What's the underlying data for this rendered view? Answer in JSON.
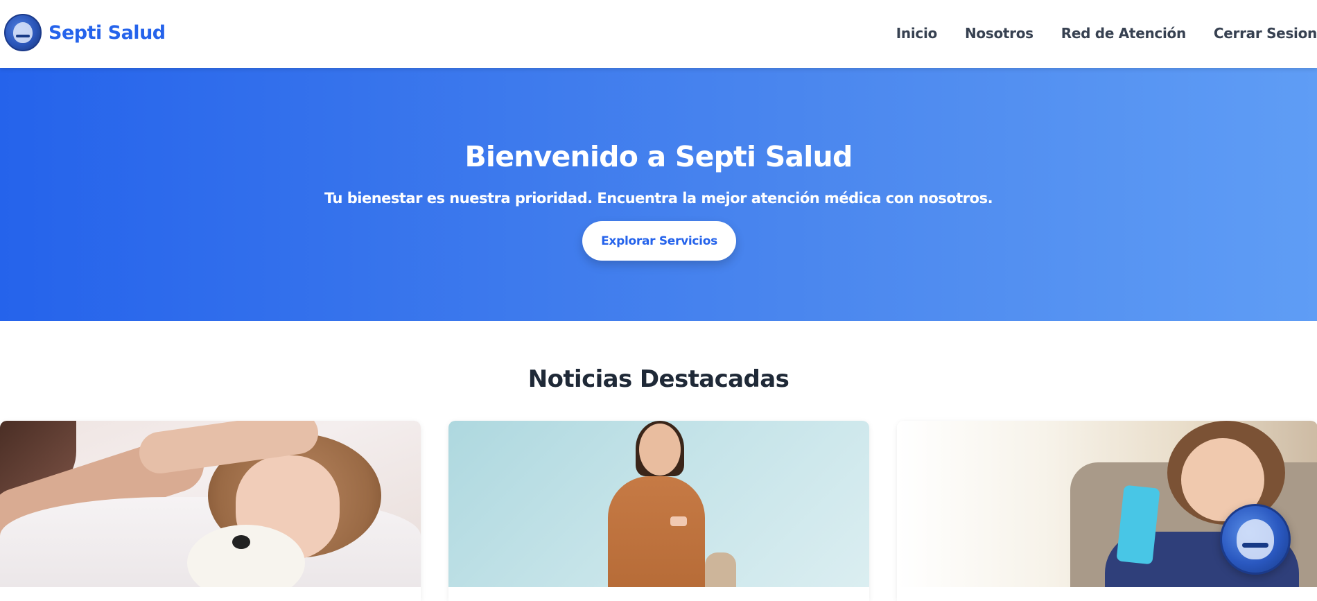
{
  "brand": {
    "name": "Septi Salud",
    "logo_icon": "mascot-logo-icon"
  },
  "nav": {
    "items": [
      {
        "label": "Inicio"
      },
      {
        "label": "Nosotros"
      },
      {
        "label": "Red de Atención"
      },
      {
        "label": "Cerrar Sesion"
      }
    ]
  },
  "hero": {
    "title": "Bienvenido a Septi Salud",
    "subtitle": "Tu bienestar es nuestra prioridad. Encuentra la mejor atención médica con nosotros.",
    "button_label": "Explorar Servicios"
  },
  "news": {
    "title": "Noticias Destacadas",
    "cards": [
      {
        "image": "sick-child-with-teddy-bear"
      },
      {
        "image": "pregnant-woman-vaccinated"
      },
      {
        "image": "woman-using-phone"
      }
    ]
  },
  "chat_widget": {
    "icon": "mascot-chat-icon"
  },
  "colors": {
    "brand": "#2563eb",
    "hero_start": "#2563eb",
    "hero_end": "#5f9df5",
    "text_dark": "#1f2937",
    "nav_text": "#374151"
  }
}
